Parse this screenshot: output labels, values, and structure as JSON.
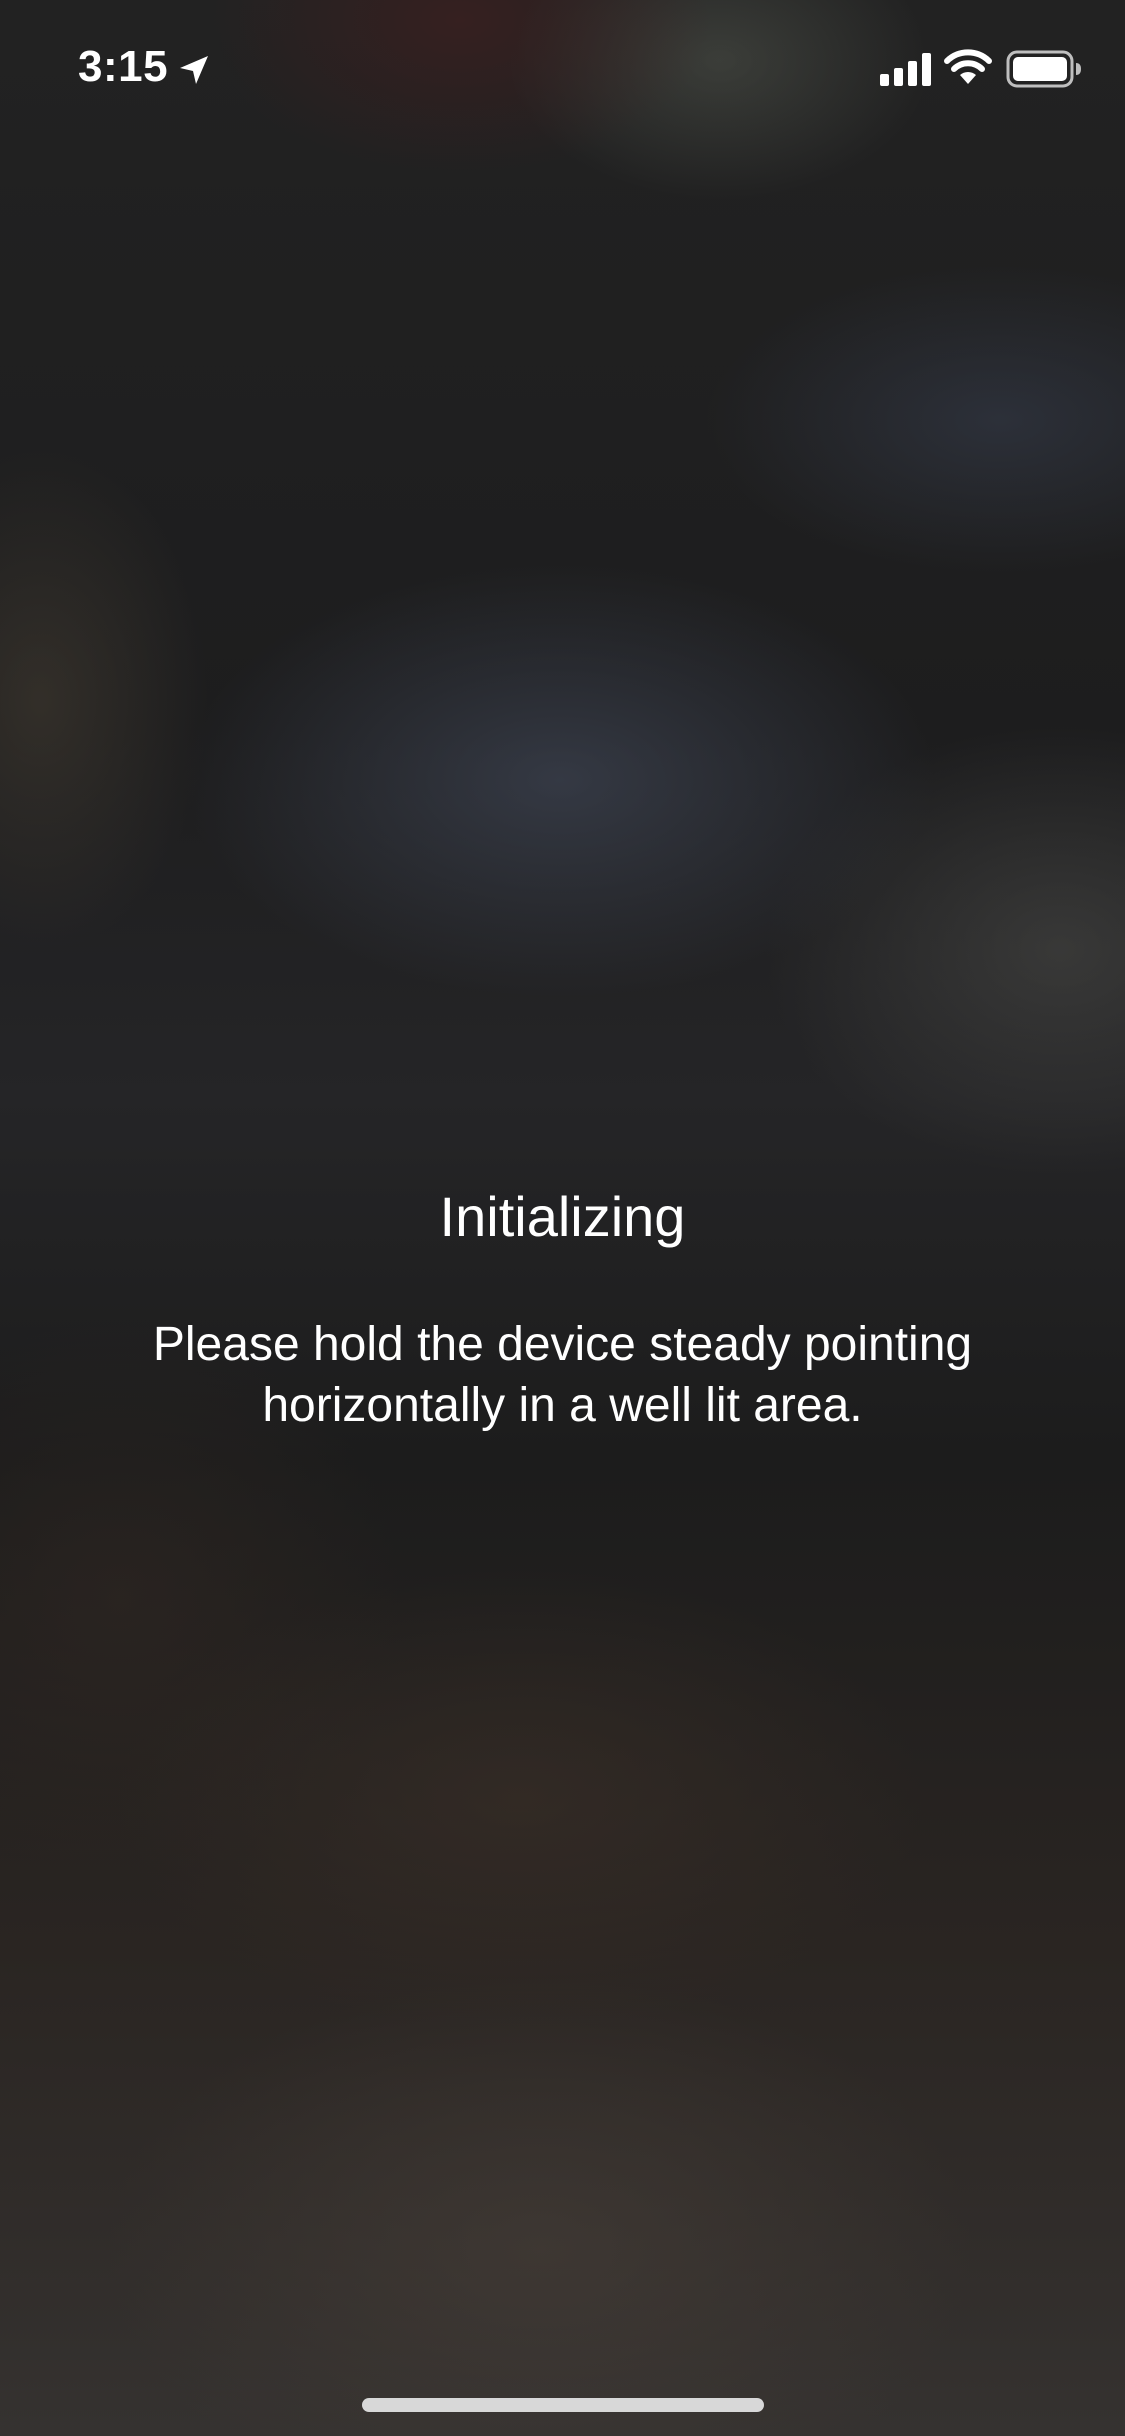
{
  "status_bar": {
    "time": "3:15",
    "icons": [
      "location-arrow-icon",
      "cellular-signal-icon",
      "wifi-icon",
      "battery-icon"
    ],
    "battery_level": 1.0
  },
  "overlay": {
    "title": "Initializing",
    "message": "Please hold the device steady pointing horizontally in a well lit area."
  },
  "colors": {
    "text": "#ffffff",
    "home_indicator": "#d8d8d8",
    "background": "#1c1c1c"
  }
}
